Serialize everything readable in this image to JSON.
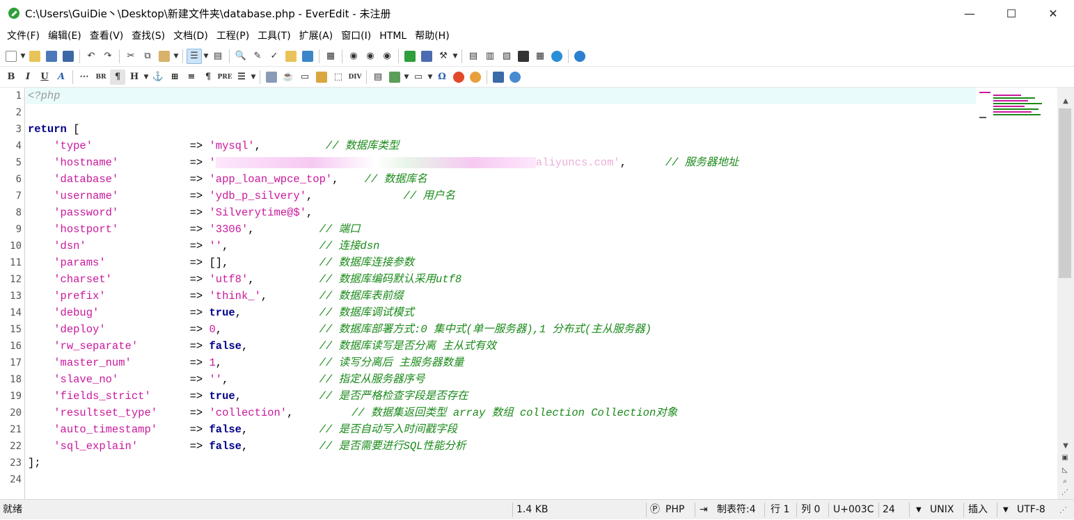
{
  "window": {
    "title": "C:\\Users\\GuiDie丶\\Desktop\\新建文件夹\\database.php - EverEdit - 未注册",
    "minimize": "—",
    "maximize": "☐",
    "close": "✕"
  },
  "menu": [
    "文件(F)",
    "编辑(E)",
    "查看(V)",
    "查找(S)",
    "文档(D)",
    "工程(P)",
    "工具(T)",
    "扩展(A)",
    "窗口(I)",
    "HTML",
    "帮助(H)"
  ],
  "format_toolbar": {
    "bold": "B",
    "italic": "I",
    "underline": "U",
    "font": "A",
    "br": "BR",
    "para": "¶",
    "heading": "H",
    "pre": "PRE",
    "div": "DIV",
    "omega": "Ω"
  },
  "code": {
    "line_numbers": [
      "1",
      "2",
      "3",
      "4",
      "5",
      "6",
      "7",
      "8",
      "9",
      "10",
      "11",
      "12",
      "13",
      "14",
      "15",
      "16",
      "17",
      "18",
      "19",
      "20",
      "21",
      "22",
      "23",
      "24"
    ],
    "php_open": "<?php",
    "return_kw": "return",
    "open_bracket": " [",
    "close_bracket": "];",
    "arrow": "=> ",
    "entries": [
      {
        "key": "'type'",
        "value": "'mysql'",
        "vtype": "s",
        "tail": ",          ",
        "comment": "// 数据库类型"
      },
      {
        "key": "'hostname'",
        "value": "'",
        "vtype": "s",
        "masked": true,
        "value_end": "aliyuncs.com'",
        "tail": ",      ",
        "comment": "// 服务器地址"
      },
      {
        "key": "'database'",
        "value": "'app_loan_wpce_top'",
        "vtype": "s",
        "tail": ",    ",
        "comment": "// 数据库名"
      },
      {
        "key": "'username'",
        "value": "'ydb_p_silvery'",
        "vtype": "s",
        "tail": ",              ",
        "comment": "// 用户名"
      },
      {
        "key": "'password'",
        "value": "'Silverytime@$'",
        "vtype": "s",
        "tail": ",",
        "comment": ""
      },
      {
        "key": "'hostport'",
        "value": "'3306'",
        "vtype": "s",
        "tail": ",          ",
        "comment": "// 端口"
      },
      {
        "key": "'dsn'",
        "value": "''",
        "vtype": "s",
        "tail": ",              ",
        "comment": "// 连接dsn"
      },
      {
        "key": "'params'",
        "value": "[]",
        "vtype": "p",
        "tail": ",              ",
        "comment": "// 数据库连接参数"
      },
      {
        "key": "'charset'",
        "value": "'utf8'",
        "vtype": "s",
        "tail": ",          ",
        "comment": "// 数据库编码默认采用utf8"
      },
      {
        "key": "'prefix'",
        "value": "'think_'",
        "vtype": "s",
        "tail": ",        ",
        "comment": "// 数据库表前缀"
      },
      {
        "key": "'debug'",
        "value": "true",
        "vtype": "k",
        "tail": ",            ",
        "comment": "// 数据库调试模式"
      },
      {
        "key": "'deploy'",
        "value": "0",
        "vtype": "s",
        "tail": ",               ",
        "comment": "// 数据库部署方式:0 集中式(单一服务器),1 分布式(主从服务器)"
      },
      {
        "key": "'rw_separate'",
        "value": "false",
        "vtype": "k",
        "tail": ",           ",
        "comment": "// 数据库读写是否分离 主从式有效"
      },
      {
        "key": "'master_num'",
        "value": "1",
        "vtype": "s",
        "tail": ",               ",
        "comment": "// 读写分离后 主服务器数量"
      },
      {
        "key": "'slave_no'",
        "value": "''",
        "vtype": "s",
        "tail": ",              ",
        "comment": "// 指定从服务器序号"
      },
      {
        "key": "'fields_strict'",
        "value": "true",
        "vtype": "k",
        "tail": ",            ",
        "comment": "// 是否严格检查字段是否存在"
      },
      {
        "key": "'resultset_type'",
        "value": "'collection'",
        "vtype": "s",
        "tail": ",         ",
        "comment": "// 数据集返回类型 array 数组 collection Collection对象"
      },
      {
        "key": "'auto_timestamp'",
        "value": "false",
        "vtype": "k",
        "tail": ",           ",
        "comment": "// 是否自动写入时间戳字段"
      },
      {
        "key": "'sql_explain'",
        "value": "false",
        "vtype": "k",
        "tail": ",           ",
        "comment": "// 是否需要进行SQL性能分析"
      }
    ]
  },
  "status": {
    "state": "就绪",
    "size": "1.4 KB",
    "lang": "PHP",
    "tab": "制表符:4",
    "row": "行 1",
    "col": "列 0",
    "char": "U+003C",
    "font_size": "24",
    "eol": "UNIX",
    "mode": "插入",
    "encoding": "UTF-8"
  },
  "colors": {
    "keyword": "#00008b",
    "string": "#c9189b",
    "comment": "#1a8a1a",
    "current_line": "#e9fbfb"
  }
}
